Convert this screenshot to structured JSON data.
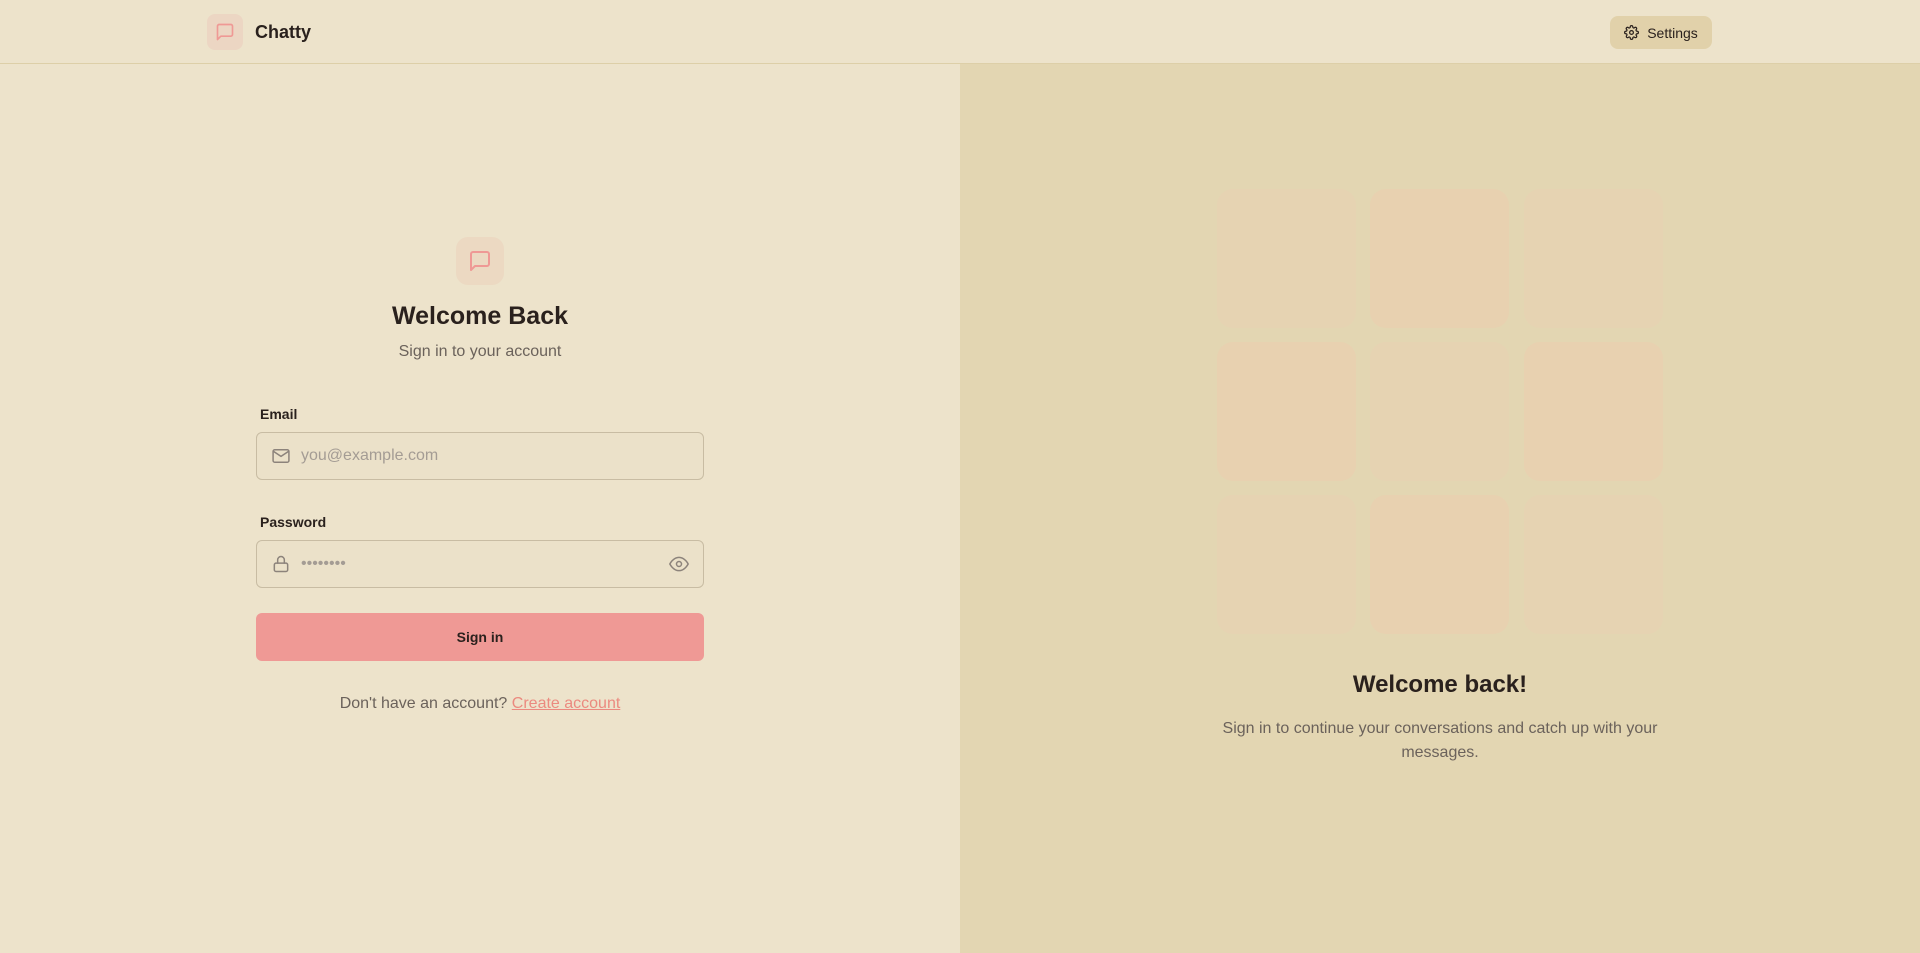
{
  "app": {
    "brand_name": "Chatty",
    "settings_label": "Settings"
  },
  "login": {
    "title": "Welcome Back",
    "subtitle": "Sign in to your account",
    "email_label": "Email",
    "email_placeholder": "you@example.com",
    "email_value": "",
    "password_label": "Password",
    "password_placeholder": "••••••••",
    "password_value": "",
    "submit_label": "Sign in",
    "signup_prompt": "Don't have an account?",
    "signup_link": "Create account"
  },
  "promo": {
    "title": "Welcome back!",
    "description": "Sign in to continue your conversations and catch up with your messages.",
    "tile_count": 9
  },
  "icons": {
    "brand": "message-square-icon",
    "settings": "gear-icon",
    "email": "mail-icon",
    "password": "lock-icon",
    "toggle_password": "eye-icon"
  },
  "colors": {
    "background": "#ede3cb",
    "panel_right": "#e3d6b2",
    "primary": "#ef9995",
    "link": "#eb8a7f",
    "text": "#2a211d",
    "muted_text": "#6b625b"
  }
}
